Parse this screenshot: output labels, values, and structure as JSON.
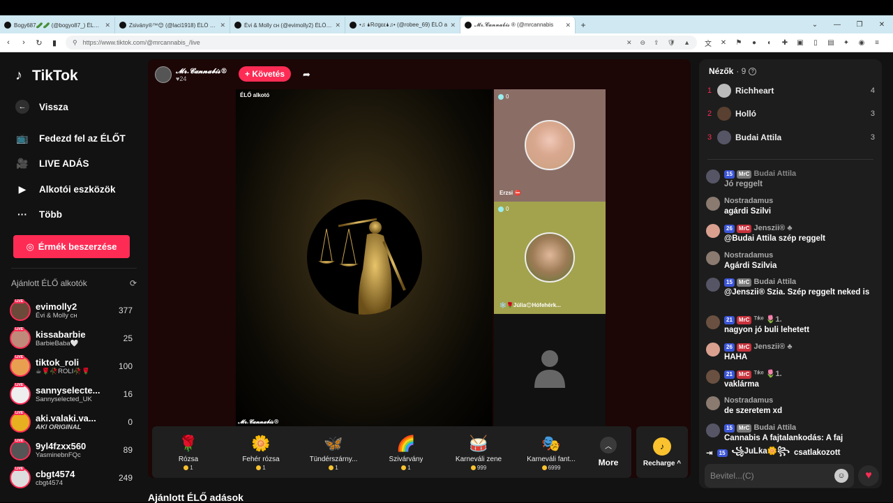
{
  "browser": {
    "tabs": [
      {
        "title": "Bogy687🥒🥒 (@bogyo87_) ÉLŐ a"
      },
      {
        "title": "Zsivány®™😊 (@laci1918) ÉLŐ adás"
      },
      {
        "title": "Évi & Molly ᴄʜ (@evimolly2) ÉLŐ adá"
      },
      {
        "title": "•♫ 🌢Rσgεε🌢♫• (@robee_69) ÉLŐ a"
      },
      {
        "title": "𝓜𝓻.𝓒𝓪𝓷𝓷𝓪𝓫𝓲𝓼 ® (@mrcannabis"
      }
    ],
    "url": "https://www.tiktok.com/@mrcannabis_/live"
  },
  "sidebar": {
    "logo": "TikTok",
    "back": "Vissza",
    "nav": [
      {
        "label": "Fedezd fel az ÉLŐT",
        "icon": "live-tv-icon"
      },
      {
        "label": "LIVE ADÁS",
        "icon": "camera-icon"
      },
      {
        "label": "Alkotói eszközök",
        "icon": "creator-tools-icon"
      },
      {
        "label": "Több",
        "icon": "more-dots-icon"
      }
    ],
    "coins_button": "Érmék beszerzése",
    "recommended_title": "Ajánlott ÉLŐ alkotók",
    "live_badge": "LIVE",
    "creators": [
      {
        "name": "evimolly2",
        "sub": "Évi & Molly ᴄʜ",
        "count": "377"
      },
      {
        "name": "kissabarbie",
        "sub": "BarbieBaba🤍",
        "count": "25"
      },
      {
        "name": "tiktok_roli",
        "sub": "☕🌹🥀ROLI🥀🌹",
        "count": "100"
      },
      {
        "name": "sannyselecte...",
        "sub": "Sannyselected_UK",
        "count": "16"
      },
      {
        "name": "aki.valaki.va...",
        "sub": "AKI ORIGINAL",
        "count": "0"
      },
      {
        "name": "9yl4fzxx560",
        "sub": "YasminebnFQc",
        "count": "89"
      },
      {
        "name": "cbgt4574",
        "sub": "cbgt4574",
        "count": "249"
      }
    ]
  },
  "stage": {
    "host_name": "𝓜𝓻.𝓒𝓪𝓷𝓷𝓪𝓫𝓲𝓼®",
    "host_likes": "♥24",
    "follow": "+ Követés",
    "creator_label": "ÉLŐ alkotó",
    "bottom_tag": "𝓜𝓻.𝓒𝓪𝓷𝓷𝓪𝓫𝓲𝓼®",
    "guests": [
      {
        "count": "0",
        "name": "Erzsi ⛔"
      },
      {
        "count": "0",
        "name": "❄️🌹Júlia😊Hófehérk..."
      }
    ]
  },
  "gifts": [
    {
      "name": "Rózsa",
      "price": "1",
      "icon": "🌹"
    },
    {
      "name": "Fehér rózsa",
      "price": "1",
      "icon": "🌼"
    },
    {
      "name": "Tündérszárny...",
      "price": "1",
      "icon": "🦋"
    },
    {
      "name": "Szivárvány",
      "price": "1",
      "icon": "🌈"
    },
    {
      "name": "Karneváli zene",
      "price": "999",
      "icon": "🥁"
    },
    {
      "name": "Karneváli fant...",
      "price": "6999",
      "icon": "🎭"
    }
  ],
  "more_label": "More",
  "recharge_label": "Recharge ^",
  "suggested_heading": "Ajánlott ÉLŐ adások",
  "chat": {
    "viewers_title": "Nézők",
    "viewers_count": "· 9",
    "top_viewers": [
      {
        "rank": "1",
        "name": "Richheart",
        "score": "4"
      },
      {
        "rank": "2",
        "name": "Holló",
        "score": "3"
      },
      {
        "rank": "3",
        "name": "Budai Attila",
        "score": "3"
      }
    ],
    "messages": [
      {
        "badges": [
          "15",
          "MrC"
        ],
        "user": "Budai Attila",
        "text": "Jó reggelt",
        "dim": true
      },
      {
        "badges": [],
        "user": "Nostradamus",
        "text": "agárdi Szilvi"
      },
      {
        "badges": [
          "26",
          "MrC"
        ],
        "user": "Jenszii® ♣",
        "text": "@Budai Attila szép reggelt"
      },
      {
        "badges": [],
        "user": "Nostradamus",
        "text": "Agárdi Szilvia"
      },
      {
        "badges": [
          "15",
          "MrC"
        ],
        "user": "Budai Attila",
        "text": "@Jenszii® Szia. Szép reggelt neked is"
      },
      {
        "badges": [
          "21",
          "MrC"
        ],
        "user": "ᵀᶦᵏᵉ  🌷1.",
        "text": "nagyon jó buli lehetett"
      },
      {
        "badges": [
          "26",
          "MrC"
        ],
        "user": "Jenszii® ♣",
        "text": "HAHA"
      },
      {
        "badges": [
          "21",
          "MrC"
        ],
        "user": "ᵀᶦᵏᵉ  🌷1.",
        "text": "vaklárma"
      },
      {
        "badges": [],
        "user": "Nostradamus",
        "text": "de szeretem xd"
      },
      {
        "badges": [
          "15",
          "MrC"
        ],
        "user": "Budai Attila",
        "text": "Cannabis A fajtalankodás: A faj"
      }
    ],
    "joined": {
      "badge": "15",
      "user": "꧁JuLka🌼꧂",
      "action": "csatlakozott"
    },
    "input_placeholder": "Bevitel...(C)"
  },
  "colors": {
    "accent": "#fe2c55",
    "coin": "#f9c22e",
    "badge_blue": "#3b55d6",
    "badge_red": "#c8323c"
  }
}
